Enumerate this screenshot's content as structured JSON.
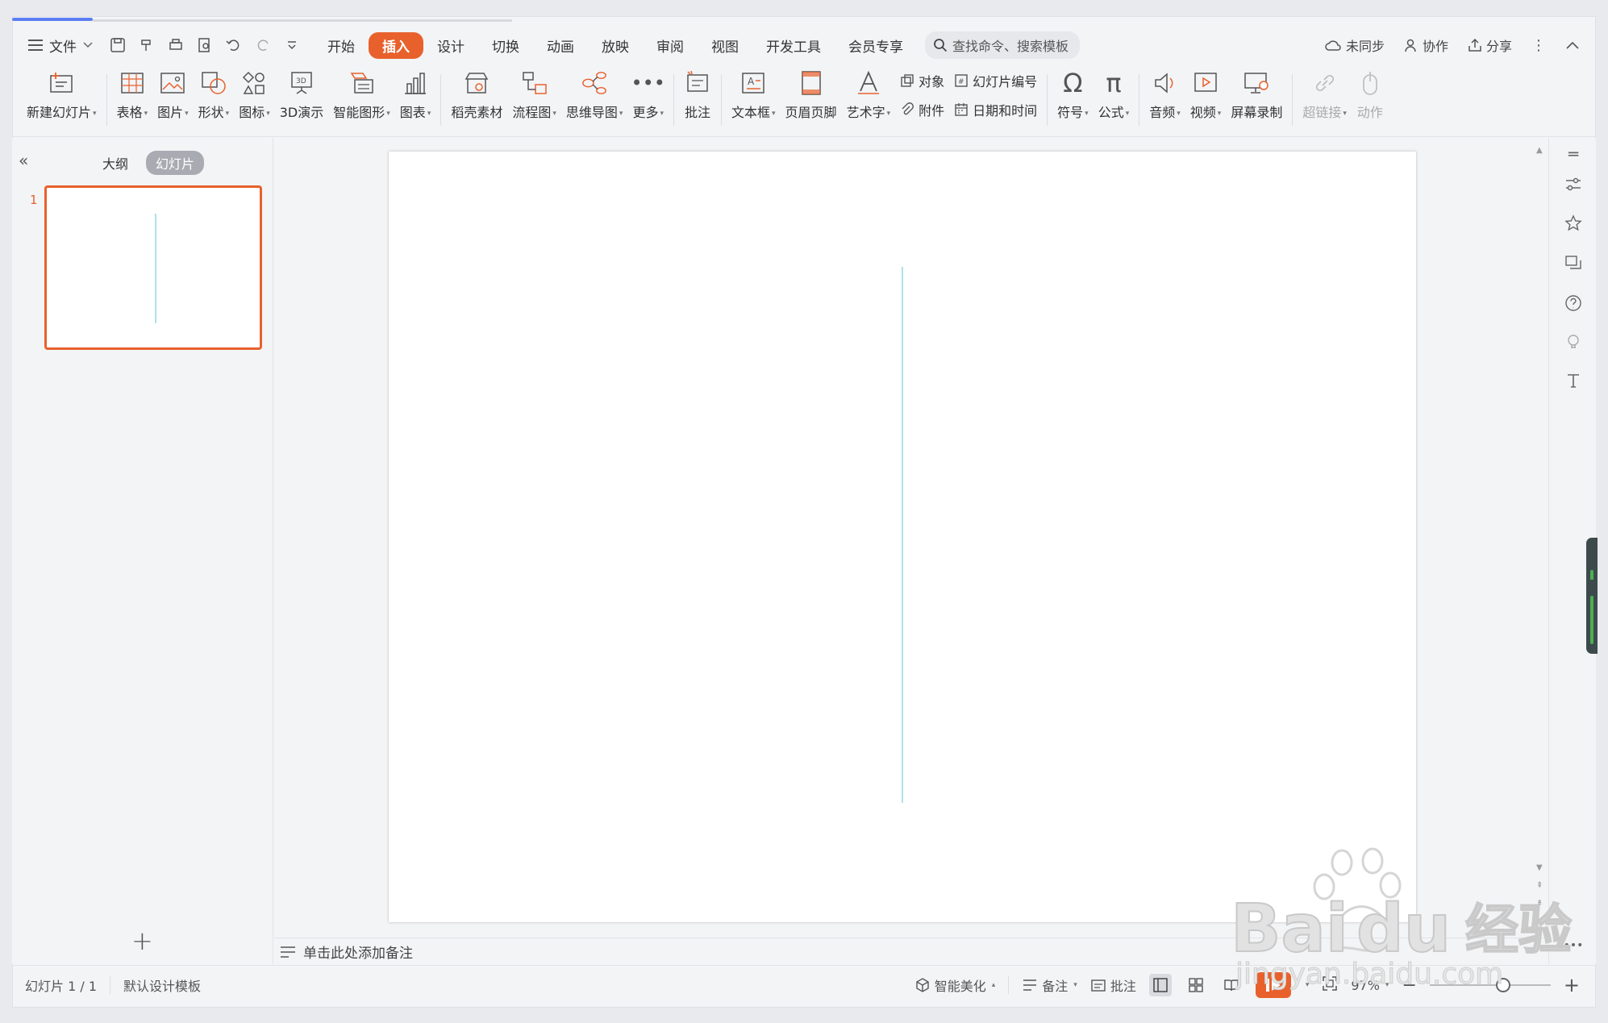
{
  "menubar": {
    "file_label": "文件",
    "tabs": [
      "开始",
      "插入",
      "设计",
      "切换",
      "动画",
      "放映",
      "审阅",
      "视图",
      "开发工具",
      "会员专享"
    ],
    "search_placeholder": "查找命令、搜索模板",
    "sync_label": "未同步",
    "collab_label": "协作",
    "share_label": "分享"
  },
  "ribbon": {
    "new_slide": "新建幻灯片",
    "table": "表格",
    "picture": "图片",
    "shape": "形状",
    "icon": "图标",
    "demo3d": "3D演示",
    "smartart": "智能图形",
    "chart": "图表",
    "material": "稻壳素材",
    "flowchart": "流程图",
    "mindmap": "思维导图",
    "more": "更多",
    "comment": "批注",
    "textbox": "文本框",
    "header_footer": "页眉页脚",
    "wordart": "艺术字",
    "object": "对象",
    "slide_number": "幻灯片编号",
    "attachment": "附件",
    "datetime": "日期和时间",
    "symbol": "符号",
    "formula": "公式",
    "audio": "音频",
    "video": "视频",
    "screen_record": "屏幕录制",
    "hyperlink": "超链接",
    "action": "动作"
  },
  "left_panel": {
    "tab_outline": "大纲",
    "tab_slides": "幻灯片",
    "slide_number": "1"
  },
  "notes": {
    "placeholder": "单击此处添加备注"
  },
  "status": {
    "slide_info": "幻灯片 1 / 1",
    "template": "默认设计模板",
    "beautify": "智能美化",
    "notes": "备注",
    "comment": "批注",
    "zoom": "97%"
  },
  "colors": {
    "accent": "#e8612d",
    "slide_line": "#aee3e8"
  }
}
